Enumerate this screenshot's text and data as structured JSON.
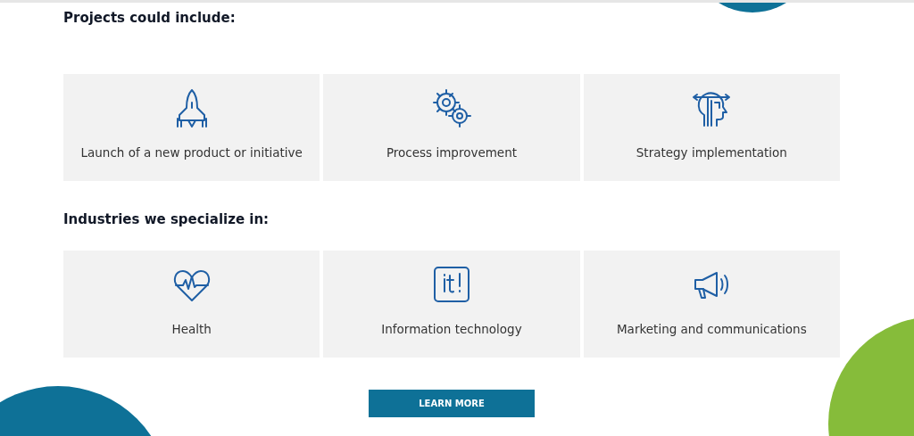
{
  "sections": [
    {
      "heading": "Projects could include:",
      "items": [
        {
          "kind": "rocket",
          "label": "Launch of a new product or initiative"
        },
        {
          "kind": "gears",
          "label": "Process improvement"
        },
        {
          "kind": "head",
          "label": "Strategy implementation"
        }
      ]
    },
    {
      "heading": "Industries we specialize in:",
      "items": [
        {
          "kind": "heart",
          "label": "Health"
        },
        {
          "kind": "it",
          "label": "Information technology"
        },
        {
          "kind": "megaphone",
          "label": "Marketing and communications"
        }
      ]
    }
  ],
  "button": "LEARN MORE"
}
